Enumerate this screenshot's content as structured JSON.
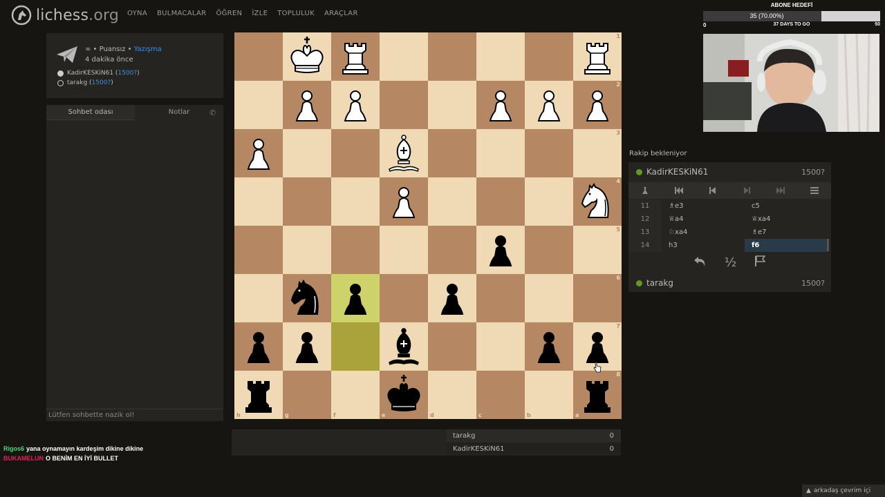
{
  "brand": {
    "name": "lichess",
    "tld": ".org"
  },
  "nav": [
    {
      "label": "OYNA"
    },
    {
      "label": "BULMACALAR"
    },
    {
      "label": "ÖĞREN"
    },
    {
      "label": "İZLE"
    },
    {
      "label": "TOPLULUK"
    },
    {
      "label": "ARAÇLAR"
    }
  ],
  "game_meta": {
    "mode_prefix": "∞ • Puansız • ",
    "mode_link": "Yazışma",
    "time_ago": "4 dakika önce",
    "white_name": "KadirKESKiN61",
    "white_rating": "1500?",
    "black_name": "tarakg",
    "black_rating": "1500?"
  },
  "chat": {
    "tab_chat": "Sohbet odası",
    "tab_notes": "Notlar",
    "placeholder": "Lütfen sohbette nazik ol!"
  },
  "stream_chat": [
    {
      "user": "Rigos6",
      "text": "yana oynamayın kardeşim dikine dikine"
    },
    {
      "user": "BUKAMELUN",
      "text": "O BENİM EN İYİ BULLET"
    }
  ],
  "board": {
    "orientation": "black",
    "rank_labels": [
      "1",
      "2",
      "3",
      "4",
      "5",
      "6",
      "7",
      "8"
    ],
    "file_labels": [
      "h",
      "g",
      "f",
      "e",
      "d",
      "c",
      "b",
      "a"
    ],
    "highlight_squares": [
      "f6",
      "f7"
    ],
    "pieces": [
      {
        "square": "g1",
        "piece": "wK"
      },
      {
        "square": "f1",
        "piece": "wR"
      },
      {
        "square": "a1",
        "piece": "wR"
      },
      {
        "square": "g2",
        "piece": "wP"
      },
      {
        "square": "f2",
        "piece": "wP"
      },
      {
        "square": "c2",
        "piece": "wP"
      },
      {
        "square": "b2",
        "piece": "wP"
      },
      {
        "square": "a2",
        "piece": "wP"
      },
      {
        "square": "h3",
        "piece": "wP"
      },
      {
        "square": "e3",
        "piece": "wB"
      },
      {
        "square": "e4",
        "piece": "wP"
      },
      {
        "square": "a4",
        "piece": "wN"
      },
      {
        "square": "c5",
        "piece": "bP"
      },
      {
        "square": "g6",
        "piece": "bN"
      },
      {
        "square": "f6",
        "piece": "bP"
      },
      {
        "square": "d6",
        "piece": "bP"
      },
      {
        "square": "h7",
        "piece": "bP"
      },
      {
        "square": "g7",
        "piece": "bP"
      },
      {
        "square": "e7",
        "piece": "bB"
      },
      {
        "square": "b7",
        "piece": "bP"
      },
      {
        "square": "a7",
        "piece": "bP"
      },
      {
        "square": "h8",
        "piece": "bR"
      },
      {
        "square": "e8",
        "piece": "bK"
      },
      {
        "square": "a8",
        "piece": "bR"
      }
    ]
  },
  "scores": [
    {
      "name": "tarakg",
      "score": "0"
    },
    {
      "name": "KadirKESKiN61",
      "score": "0"
    }
  ],
  "sub_goal": {
    "title": "ABONE HEDEFİ",
    "current_label": "35 (70.00%)",
    "progress": 0.7,
    "min": "0",
    "days": "37 DAYS TO GO",
    "max": "50"
  },
  "status_text": "Rakip bekleniyor",
  "opponent": {
    "name": "KadirKESKiN61",
    "rating": "1500?"
  },
  "player": {
    "name": "tarakg",
    "rating": "1500?"
  },
  "moves": [
    {
      "num": "11",
      "white": "♗e3",
      "black": "c5"
    },
    {
      "num": "12",
      "white": "♕a4",
      "black": "♕xa4"
    },
    {
      "num": "13",
      "white": "♘xa4",
      "black": "♗e7"
    },
    {
      "num": "14",
      "white": "h3",
      "black": "f6"
    }
  ],
  "active_move": "14b",
  "friends": "arkadaş çevrim içi",
  "colors": {
    "light": "#f0d9b5",
    "dark": "#b58863",
    "highlight_light": "#cdd26a",
    "highlight_dark": "#aaa23a",
    "link": "#3692e7"
  }
}
